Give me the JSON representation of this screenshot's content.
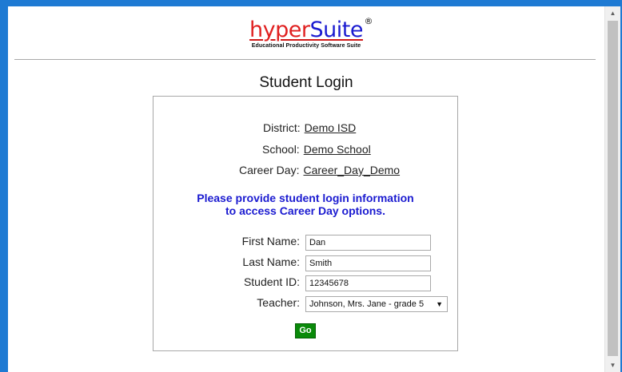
{
  "logo": {
    "part1": "hyper",
    "part2": "Suite",
    "reg": "®",
    "tagline": "Educational Productivity Software Suite",
    "colors": {
      "hyper": "#e02020",
      "suite": "#1a1ad0"
    }
  },
  "page": {
    "title": "Student Login"
  },
  "info": {
    "district": {
      "label": "District:",
      "value": "Demo ISD"
    },
    "school": {
      "label": "School:",
      "value": "Demo School"
    },
    "career_day": {
      "label": "Career Day:",
      "value": "Career_Day_Demo"
    }
  },
  "notice": {
    "line1": "Please provide student login information",
    "line2": "to access Career Day options."
  },
  "form": {
    "first_name": {
      "label": "First Name:",
      "value": "Dan"
    },
    "last_name": {
      "label": "Last Name:",
      "value": "Smith"
    },
    "student_id": {
      "label": "Student ID:",
      "value": "12345678"
    },
    "teacher": {
      "label": "Teacher:",
      "selected": "Johnson, Mrs. Jane - grade 5"
    },
    "go_label": "Go"
  },
  "theme": {
    "window_border": "#1e7ad3",
    "go_button": "#0a8a0a",
    "notice_text": "#1a1ad0"
  }
}
